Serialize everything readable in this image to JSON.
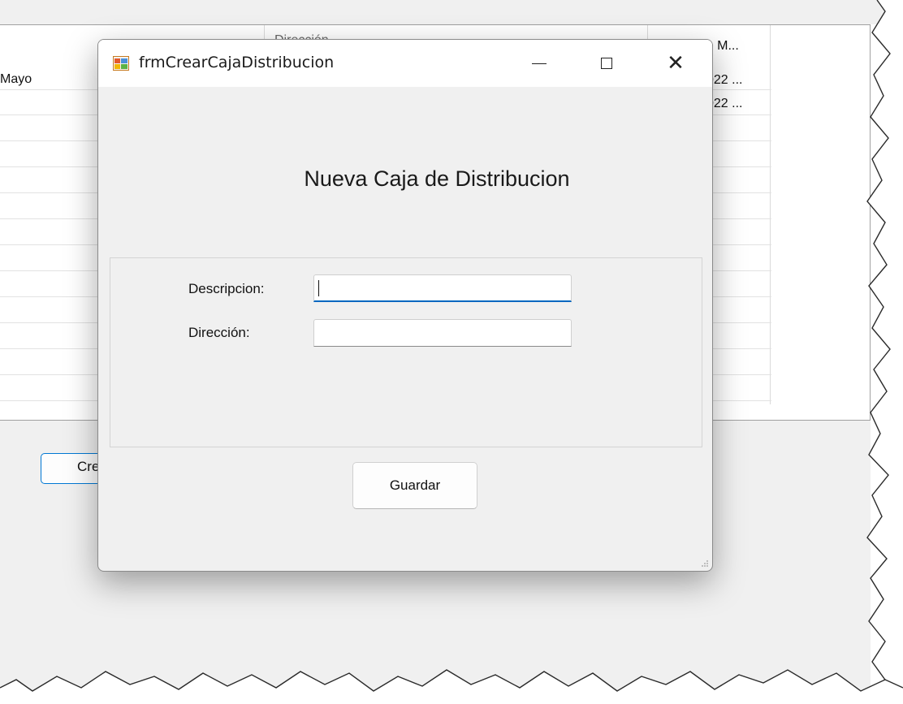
{
  "background": {
    "grid": {
      "header_partial": [
        "Mayo",
        "Dirección",
        "Fecha de M..."
      ],
      "rows_partial": [
        "022 ...",
        "022 ..."
      ]
    },
    "crear_button_partial": "Cre"
  },
  "dialog": {
    "title": "frmCrearCajaDistribucion",
    "heading": "Nueva Caja de Distribucion",
    "fields": {
      "descripcion_label": "Descripcion:",
      "descripcion_value": "",
      "direccion_label": "Dirección:",
      "direccion_value": ""
    },
    "save_label": "Guardar",
    "controls": {
      "minimize": "minimize-icon",
      "maximize": "maximize-icon",
      "close": "close-icon"
    }
  },
  "colors": {
    "accent": "#0078d4",
    "dialog_bg": "#f0f0f0",
    "titlebar_bg": "#ffffff"
  }
}
